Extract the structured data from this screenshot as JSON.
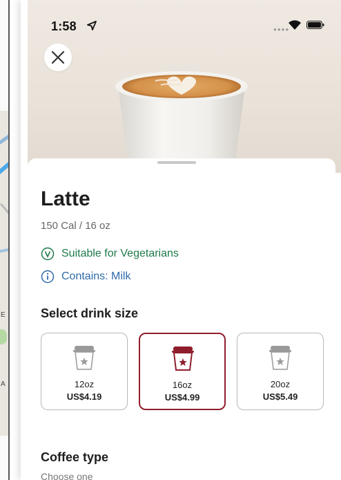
{
  "status": {
    "time": "1:58"
  },
  "product": {
    "name": "Latte",
    "nutrition": "150 Cal / 16 oz",
    "tags": [
      {
        "label": "Suitable for Vegetarians",
        "icon": "v-circle-icon",
        "color": "#1e7a4a"
      },
      {
        "label": "Contains: Milk",
        "icon": "info-icon",
        "color": "#2f6aa8"
      }
    ]
  },
  "size_section": {
    "title": "Select drink size",
    "options": [
      {
        "size": "12oz",
        "price": "US$4.19",
        "selected": false
      },
      {
        "size": "16oz",
        "price": "US$4.99",
        "selected": true
      },
      {
        "size": "20oz",
        "price": "US$5.49",
        "selected": false
      }
    ]
  },
  "coffee_section": {
    "title": "Coffee type",
    "subtitle": "Choose one"
  },
  "colors": {
    "accent": "#8f1d2c",
    "veg_green": "#1e7a4a",
    "info_blue": "#2f6aa8"
  },
  "map_labels": [
    "E",
    "A"
  ]
}
